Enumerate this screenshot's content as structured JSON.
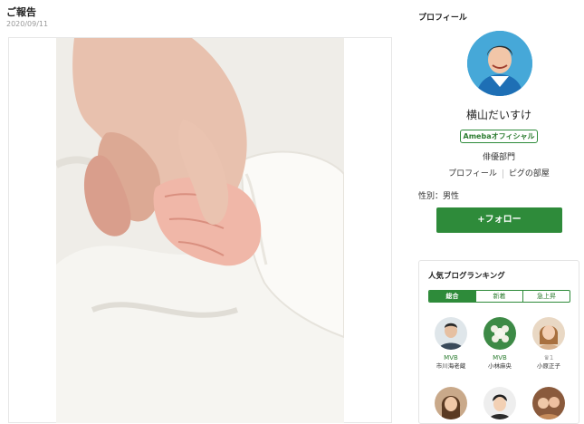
{
  "post": {
    "title": "ご報告",
    "date": "2020/09/11"
  },
  "sidebar": {
    "heading": "プロフィール",
    "name": "横山だいすけ",
    "badge": "Amebaオフィシャル",
    "category": "俳優部門",
    "links": [
      "プロフィール",
      "ピグの部屋"
    ],
    "gender": "性別：男性",
    "follow_label": "+フォロー"
  },
  "ranking": {
    "title": "人気ブログランキング",
    "tabs": [
      "総合",
      "新着",
      "急上昇"
    ],
    "active_tab": "総合",
    "items": [
      {
        "badge": "MVB",
        "name": "市川海老蔵"
      },
      {
        "badge": "MVB",
        "name": "小林麻央"
      },
      {
        "badge": "♛1",
        "name": "小原正子"
      }
    ]
  },
  "colors": {
    "accent_green": "#2e8b3a",
    "avatar_bg": "#46a8d8"
  }
}
